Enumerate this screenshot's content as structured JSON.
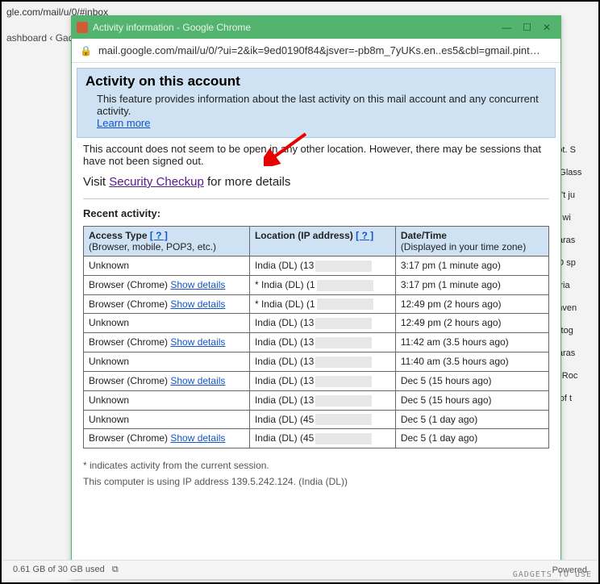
{
  "bg": {
    "parent_url_fragment": "gle.com/mail/u/0/#inbox",
    "parent_tab": "ashboard ‹ Gad",
    "snippets": [
      "e got. S",
      "a® Glass",
      "Don't ju",
      "one wi",
      "y Paras",
      "SEO sp",
      "tutoria",
      "ur inven",
      "Rastog",
      "y Paras",
      "ogi, Roc",
      "eal of t"
    ]
  },
  "popup": {
    "title": "Activity information - Google Chrome",
    "address": "mail.google.com/mail/u/0/?ui=2&ik=9ed0190f84&jsver=-pb8m_7yUKs.en..es5&cbl=gmail.pint…"
  },
  "banner": {
    "heading": "Activity on this account",
    "description": "This feature provides information about the last activity on this mail account and any concurrent activity.",
    "learn_more": "Learn more"
  },
  "main": {
    "notice": "This account does not seem to be open in any other location. However, there may be sessions that have not been signed out.",
    "visit_prefix": "Visit ",
    "security_checkup": "Security Checkup",
    "visit_suffix": " for more details",
    "recent_heading": "Recent activity:"
  },
  "table": {
    "col1_title": "Access Type",
    "col1_sub": "(Browser, mobile, POP3, etc.)",
    "col2_title": "Location (IP address)",
    "col3_title": "Date/Time",
    "col3_sub": "(Displayed in your time zone)",
    "help_icon": "[ ? ]",
    "show_details": "Show details",
    "rows": [
      {
        "access": "Unknown",
        "show": false,
        "loc": "India (DL) (13",
        "dt": "3:17 pm (1 minute ago)"
      },
      {
        "access": "Browser (Chrome)",
        "show": true,
        "loc": "* India (DL) (1",
        "dt": "3:17 pm (1 minute ago)"
      },
      {
        "access": "Browser (Chrome)",
        "show": true,
        "loc": "* India (DL) (1",
        "dt": "12:49 pm (2 hours ago)"
      },
      {
        "access": "Unknown",
        "show": false,
        "loc": "India (DL) (13",
        "dt": "12:49 pm (2 hours ago)"
      },
      {
        "access": "Browser (Chrome)",
        "show": true,
        "loc": "India (DL) (13",
        "dt": "11:42 am (3.5 hours ago)"
      },
      {
        "access": "Unknown",
        "show": false,
        "loc": "India (DL) (13",
        "dt": "11:40 am (3.5 hours ago)"
      },
      {
        "access": "Browser (Chrome)",
        "show": true,
        "loc": "India (DL) (13",
        "dt": "Dec 5 (15 hours ago)"
      },
      {
        "access": "Unknown",
        "show": false,
        "loc": "India (DL) (13",
        "dt": "Dec 5 (15 hours ago)"
      },
      {
        "access": "Unknown",
        "show": false,
        "loc": "India (DL) (45",
        "dt": "Dec 5 (1 day ago)"
      },
      {
        "access": "Browser (Chrome)",
        "show": true,
        "loc": "India (DL) (45",
        "dt": "Dec 5 (1 day ago)"
      }
    ]
  },
  "footnotes": {
    "star_note": "* indicates activity from the current session.",
    "ip_note": "This computer is using IP address 139.5.242.124. (India (DL))"
  },
  "statusbar": {
    "storage": "0.61 GB of 30 GB used",
    "powered": "Powered"
  },
  "watermark": "GADGETS TO USE"
}
